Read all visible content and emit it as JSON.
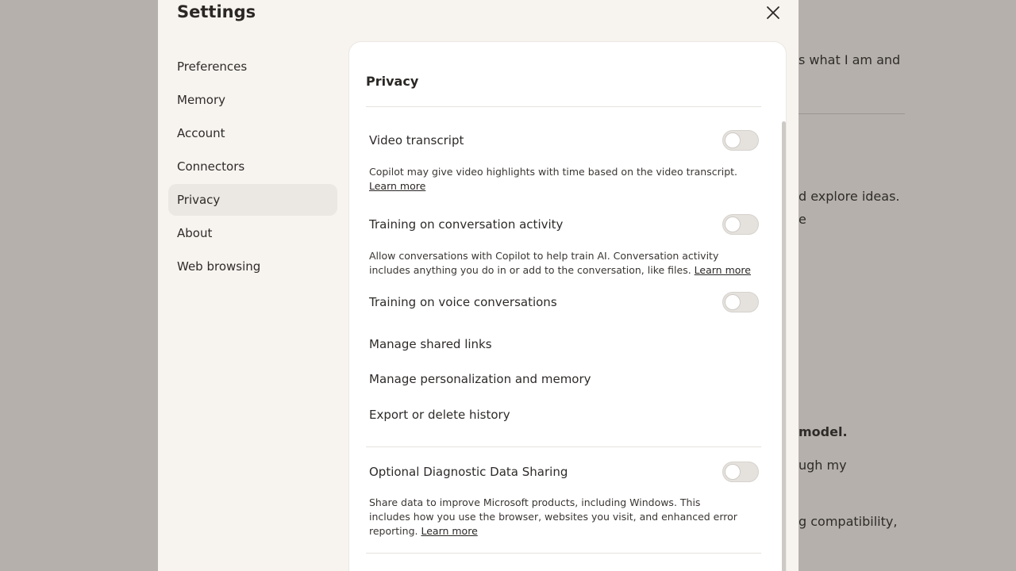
{
  "background": {
    "lines": [
      "s what I am and",
      "d explore ideas.",
      "e",
      "model.",
      "ugh my",
      "g compatibility,"
    ]
  },
  "modal": {
    "title": "Settings",
    "close_icon": "close-icon"
  },
  "nav": {
    "items": [
      {
        "label": "Preferences"
      },
      {
        "label": "Memory"
      },
      {
        "label": "Account"
      },
      {
        "label": "Connectors"
      },
      {
        "label": "Privacy"
      },
      {
        "label": "About"
      },
      {
        "label": "Web browsing"
      }
    ],
    "active": "Privacy"
  },
  "privacy": {
    "heading": "Privacy",
    "video_transcript": {
      "label": "Video transcript",
      "desc": "Copilot may give video highlights with time based on the video transcript.",
      "link": "Learn more",
      "enabled": false
    },
    "training_conversation": {
      "label": "Training on conversation activity",
      "desc": "Allow conversations with Copilot to help train AI. Conversation activity includes anything you do in or add to the conversation, like files.",
      "link": "Learn more",
      "enabled": false
    },
    "training_voice": {
      "label": "Training on voice conversations",
      "enabled": false
    },
    "manage_shared_links": "Manage shared links",
    "manage_personalization": "Manage personalization and memory",
    "export_delete_history": "Export or delete history",
    "diagnostic": {
      "label": "Optional Diagnostic Data Sharing",
      "desc": "Share data to improve Microsoft products, including Windows. This includes how you use the browser, websites you visit, and enhanced error reporting.",
      "link": "Learn more",
      "enabled": false
    }
  }
}
